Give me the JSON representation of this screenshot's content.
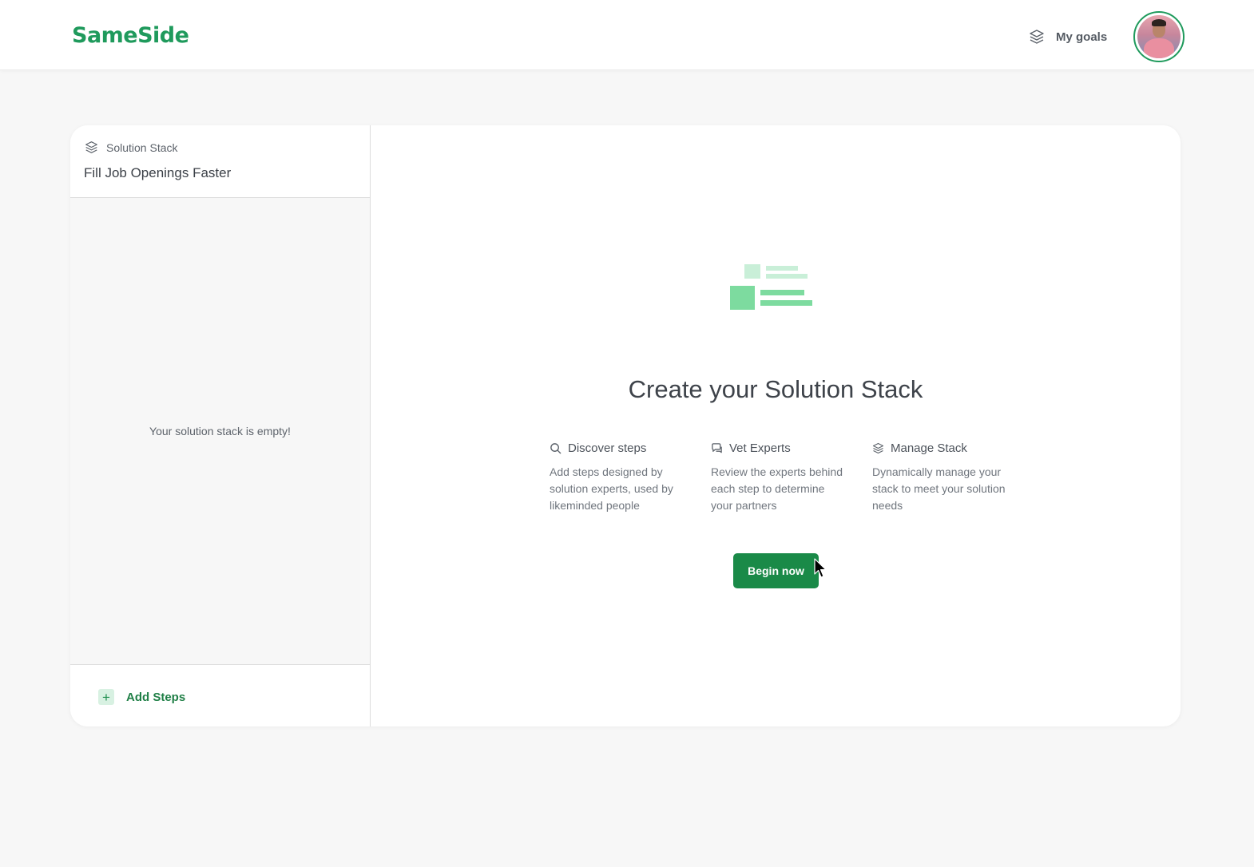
{
  "brand": {
    "name": "SameSide",
    "color": "#1f9a5c"
  },
  "header": {
    "goals_label": "My goals",
    "goals_icon": "layers-icon",
    "avatar_icon": "user-avatar"
  },
  "sidebar": {
    "kicker": "Solution Stack",
    "kicker_icon": "layers-icon",
    "title": "Fill Job Openings Faster",
    "empty_message": "Your solution stack is empty!",
    "add_steps_label": "Add Steps",
    "add_steps_icon": "plus-icon"
  },
  "main": {
    "illustration_icon": "stack-illustration",
    "title": "Create your Solution Stack",
    "features": [
      {
        "icon": "search-icon",
        "title": "Discover steps",
        "description": "Add steps designed by solution experts, used by likeminded people"
      },
      {
        "icon": "chat-icon",
        "title": "Vet Experts",
        "description": "Review the experts behind each step to determine your partners"
      },
      {
        "icon": "layers-icon",
        "title": "Manage Stack",
        "description": "Dynamically manage your stack to meet your solution needs"
      }
    ],
    "cta_label": "Begin now"
  },
  "colors": {
    "accent": "#1a8a48",
    "accent_light": "#d8f1e2",
    "illustration_light": "#c9efd8",
    "illustration_mid": "#7ddb9f",
    "background": "#f7f7f7"
  }
}
